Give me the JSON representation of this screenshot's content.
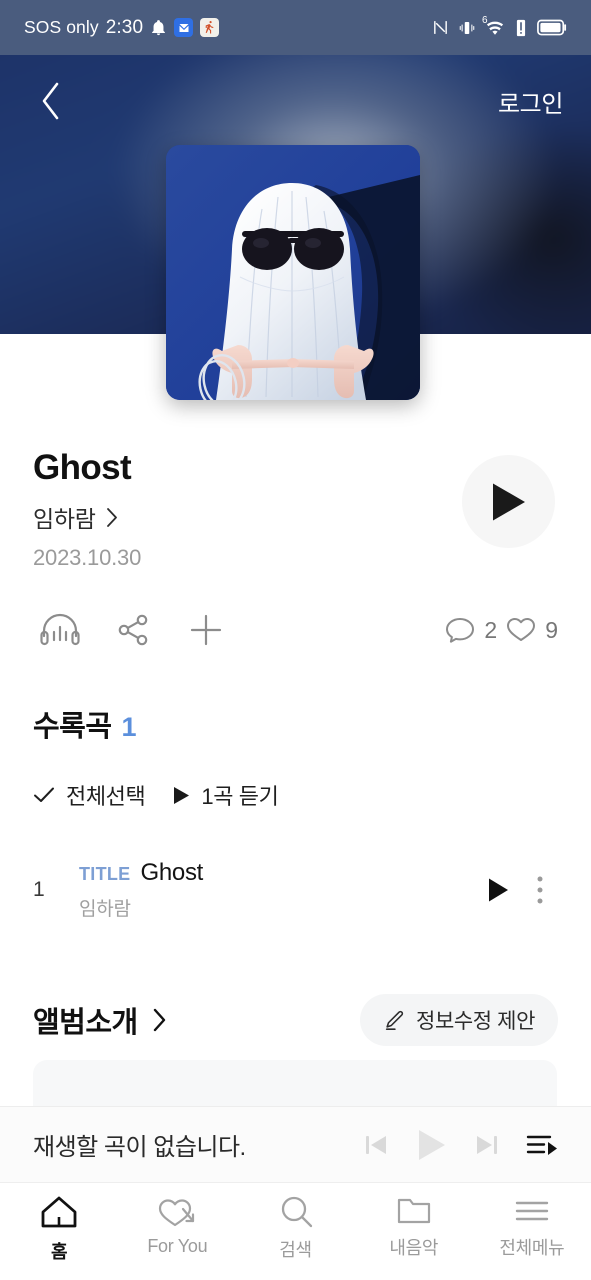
{
  "statusbar": {
    "carrier": "SOS only",
    "time": "2:30",
    "icons": [
      "bell-icon",
      "messenger-app-icon",
      "fitness-app-icon",
      "nfc-icon",
      "vibrate-icon",
      "wifi-6-icon",
      "alert-icon",
      "battery-icon"
    ],
    "wifi_label": "6"
  },
  "header": {
    "back_icon": "chevron-left-icon",
    "login_label": "로그인",
    "background_color": "#1d3166"
  },
  "album": {
    "art_alt": "ghost-album-cover",
    "title": "Ghost",
    "artist": "임하람",
    "artist_chevron": "chevron-right-icon",
    "release_date": "2023.10.30",
    "play_button_icon": "play-icon"
  },
  "actions": {
    "left": [
      {
        "name": "headphones-equalizer-icon",
        "label": ""
      },
      {
        "name": "share-icon",
        "label": ""
      },
      {
        "name": "plus-icon",
        "label": ""
      }
    ],
    "comment_icon": "comment-icon",
    "comment_count": "2",
    "like_icon": "heart-icon",
    "like_count": "9"
  },
  "tracks_section": {
    "title": "수록곡",
    "count": "1",
    "count_color": "#5b8fdc",
    "select_all_icon": "check-icon",
    "select_all_label": "전체선택",
    "play_all_icon": "play-icon",
    "play_all_label": "1곡 듣기",
    "rows": [
      {
        "number": "1",
        "badge": "TITLE",
        "badge_color": "#7d9fd4",
        "name": "Ghost",
        "artist": "임하람",
        "play_icon": "play-icon",
        "more_icon": "more-vertical-icon"
      }
    ]
  },
  "album_intro": {
    "title": "앨범소개",
    "chevron_icon": "chevron-right-icon",
    "edit_icon": "pencil-icon",
    "edit_label": "정보수정 제안"
  },
  "mini_player": {
    "message": "재생할 곡이 없습니다.",
    "prev_icon": "skip-previous-icon",
    "play_icon": "play-icon",
    "next_icon": "skip-next-icon",
    "queue_icon": "playlist-icon"
  },
  "bottom_nav": {
    "items": [
      {
        "label": "홈",
        "icon": "home-icon",
        "active": true
      },
      {
        "label": "For You",
        "icon": "heart-arrow-icon",
        "active": false
      },
      {
        "label": "검색",
        "icon": "search-icon",
        "active": false
      },
      {
        "label": "내음악",
        "icon": "folder-icon",
        "active": false
      },
      {
        "label": "전체메뉴",
        "icon": "hamburger-icon",
        "active": false
      }
    ]
  }
}
